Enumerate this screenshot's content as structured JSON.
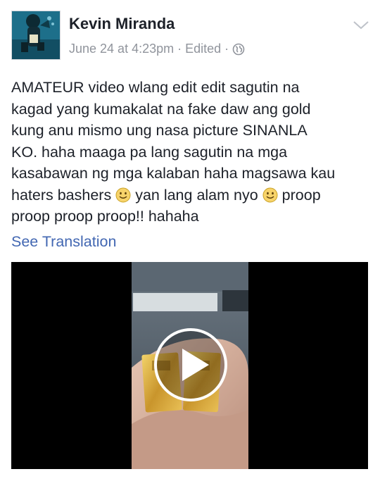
{
  "post": {
    "author": "Kevin Miranda",
    "timestamp": "June 24 at 4:23pm",
    "separator": "·",
    "edited_label": "Edited",
    "separator2": "·",
    "audience_icon": "globe-icon",
    "menu_icon": "chevron-down-icon",
    "text_lines": [
      "AMATEUR video wlang edit edit sagutin na",
      "kagad yang kumakalat na fake daw ang gold",
      "kung anu mismo ung nasa picture SINANLA",
      "KO. haha maaga pa lang sagutin na mga",
      "kasabawan ng mga kalaban haha magsawa kau"
    ],
    "line6_a": "haters bashers",
    "line6_b": "yan lang alam nyo",
    "line6_c": "proop",
    "line7": "proop proop proop!! hahaha",
    "emoji": "smiley-icon",
    "see_translation": "See Translation"
  },
  "video": {
    "play_icon": "play-icon"
  },
  "colors": {
    "author": "#1d2129",
    "meta": "#90949c",
    "link": "#4267b2",
    "video_bg": "#000000"
  }
}
